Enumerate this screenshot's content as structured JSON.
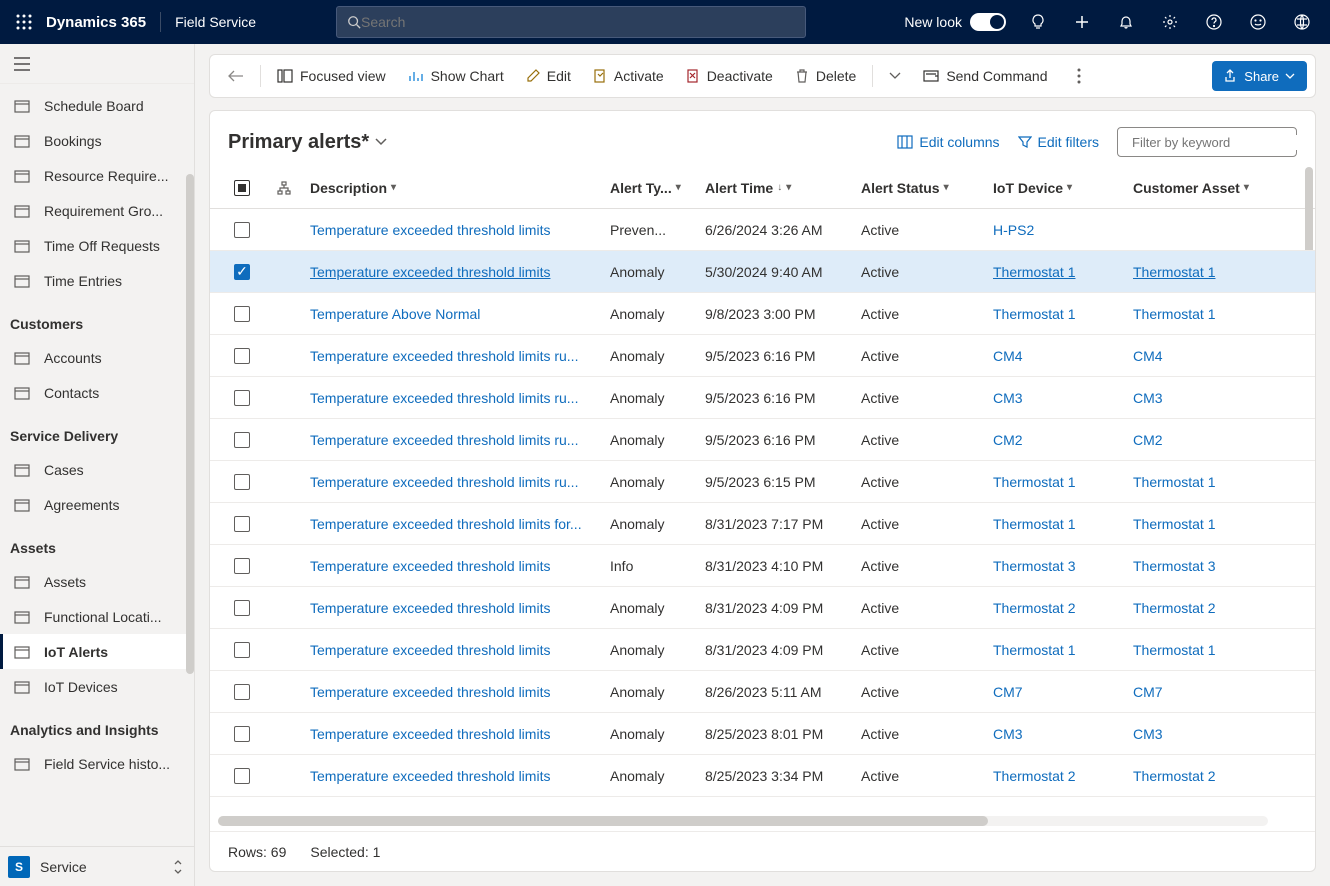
{
  "topbar": {
    "brand": "Dynamics 365",
    "module": "Field Service",
    "search_placeholder": "Search",
    "newlook": "New look"
  },
  "nav": {
    "items_top": [
      {
        "label": "Schedule Board"
      },
      {
        "label": "Bookings"
      },
      {
        "label": "Resource Require..."
      },
      {
        "label": "Requirement Gro..."
      },
      {
        "label": "Time Off Requests"
      },
      {
        "label": "Time Entries"
      }
    ],
    "heading_customers": "Customers",
    "items_customers": [
      {
        "label": "Accounts"
      },
      {
        "label": "Contacts"
      }
    ],
    "heading_service": "Service Delivery",
    "items_service": [
      {
        "label": "Cases"
      },
      {
        "label": "Agreements"
      }
    ],
    "heading_assets": "Assets",
    "items_assets": [
      {
        "label": "Assets"
      },
      {
        "label": "Functional Locati..."
      },
      {
        "label": "IoT Alerts"
      },
      {
        "label": "IoT Devices"
      }
    ],
    "heading_analytics": "Analytics and Insights",
    "items_analytics": [
      {
        "label": "Field Service histo..."
      }
    ],
    "area_badge": "S",
    "area_label": "Service"
  },
  "commands": {
    "focused": "Focused view",
    "chart": "Show Chart",
    "edit": "Edit",
    "activate": "Activate",
    "deactivate": "Deactivate",
    "delete": "Delete",
    "send": "Send Command",
    "share": "Share"
  },
  "view": {
    "title": "Primary alerts*",
    "edit_columns": "Edit columns",
    "edit_filters": "Edit filters",
    "filter_placeholder": "Filter by keyword",
    "columns": {
      "desc": "Description",
      "type": "Alert Ty...",
      "time": "Alert Time",
      "status": "Alert Status",
      "device": "IoT Device",
      "asset": "Customer Asset"
    },
    "rows": [
      {
        "desc": "Temperature exceeded threshold limits",
        "type": "Preven...",
        "time": "6/26/2024 3:26 AM",
        "status": "Active",
        "device": "H-PS2",
        "asset": "",
        "sel": false
      },
      {
        "desc": "Temperature exceeded threshold limits",
        "type": "Anomaly",
        "time": "5/30/2024 9:40 AM",
        "status": "Active",
        "device": "Thermostat 1",
        "asset": "Thermostat 1",
        "sel": true
      },
      {
        "desc": "Temperature Above Normal",
        "type": "Anomaly",
        "time": "9/8/2023 3:00 PM",
        "status": "Active",
        "device": "Thermostat 1",
        "asset": "Thermostat 1",
        "sel": false
      },
      {
        "desc": "Temperature exceeded threshold limits ru...",
        "type": "Anomaly",
        "time": "9/5/2023 6:16 PM",
        "status": "Active",
        "device": "CM4",
        "asset": "CM4",
        "sel": false
      },
      {
        "desc": "Temperature exceeded threshold limits ru...",
        "type": "Anomaly",
        "time": "9/5/2023 6:16 PM",
        "status": "Active",
        "device": "CM3",
        "asset": "CM3",
        "sel": false
      },
      {
        "desc": "Temperature exceeded threshold limits ru...",
        "type": "Anomaly",
        "time": "9/5/2023 6:16 PM",
        "status": "Active",
        "device": "CM2",
        "asset": "CM2",
        "sel": false
      },
      {
        "desc": "Temperature exceeded threshold limits ru...",
        "type": "Anomaly",
        "time": "9/5/2023 6:15 PM",
        "status": "Active",
        "device": "Thermostat 1",
        "asset": "Thermostat 1",
        "sel": false
      },
      {
        "desc": "Temperature exceeded threshold limits for...",
        "type": "Anomaly",
        "time": "8/31/2023 7:17 PM",
        "status": "Active",
        "device": "Thermostat 1",
        "asset": "Thermostat 1",
        "sel": false
      },
      {
        "desc": "Temperature exceeded threshold limits",
        "type": "Info",
        "time": "8/31/2023 4:10 PM",
        "status": "Active",
        "device": "Thermostat 3",
        "asset": "Thermostat 3",
        "sel": false
      },
      {
        "desc": "Temperature exceeded threshold limits",
        "type": "Anomaly",
        "time": "8/31/2023 4:09 PM",
        "status": "Active",
        "device": "Thermostat 2",
        "asset": "Thermostat 2",
        "sel": false
      },
      {
        "desc": "Temperature exceeded threshold limits",
        "type": "Anomaly",
        "time": "8/31/2023 4:09 PM",
        "status": "Active",
        "device": "Thermostat 1",
        "asset": "Thermostat 1",
        "sel": false
      },
      {
        "desc": "Temperature exceeded threshold limits",
        "type": "Anomaly",
        "time": "8/26/2023 5:11 AM",
        "status": "Active",
        "device": "CM7",
        "asset": "CM7",
        "sel": false
      },
      {
        "desc": "Temperature exceeded threshold limits",
        "type": "Anomaly",
        "time": "8/25/2023 8:01 PM",
        "status": "Active",
        "device": "CM3",
        "asset": "CM3",
        "sel": false
      },
      {
        "desc": "Temperature exceeded threshold limits",
        "type": "Anomaly",
        "time": "8/25/2023 3:34 PM",
        "status": "Active",
        "device": "Thermostat 2",
        "asset": "Thermostat 2",
        "sel": false
      }
    ],
    "footer_rows": "Rows: 69",
    "footer_sel": "Selected: 1"
  }
}
